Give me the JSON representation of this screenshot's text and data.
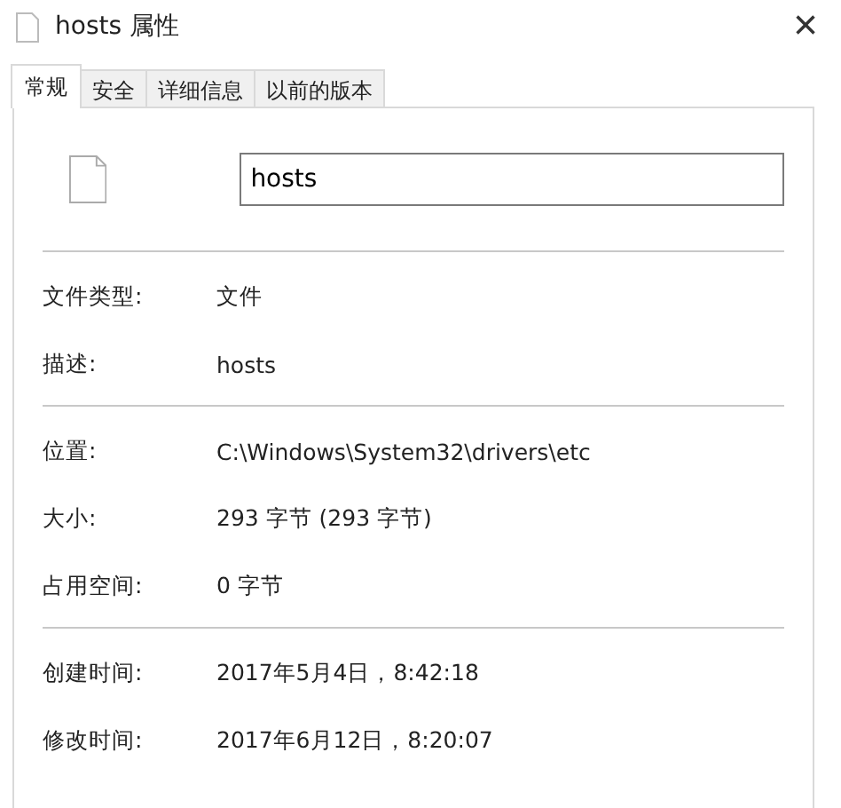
{
  "window": {
    "title": "hosts 属性",
    "close": "×"
  },
  "tabs": [
    {
      "label": "常规",
      "selected": true
    },
    {
      "label": "安全",
      "selected": false
    },
    {
      "label": "详细信息",
      "selected": false
    },
    {
      "label": "以前的版本",
      "selected": false
    }
  ],
  "name_field": {
    "value": "hosts"
  },
  "sections": [
    [
      {
        "label": "文件类型:",
        "value": "文件"
      },
      {
        "label": "描述:",
        "value": "hosts"
      }
    ],
    [
      {
        "label": "位置:",
        "value": "C:\\Windows\\System32\\drivers\\etc"
      },
      {
        "label": "大小:",
        "value": "293 字节 (293 字节)"
      },
      {
        "label": "占用空间:",
        "value": "0 字节"
      }
    ],
    [
      {
        "label": "创建时间:",
        "value": "2017年5月4日，8:42:18"
      },
      {
        "label": "修改时间:",
        "value": "2017年6月12日，8:20:07"
      }
    ]
  ]
}
